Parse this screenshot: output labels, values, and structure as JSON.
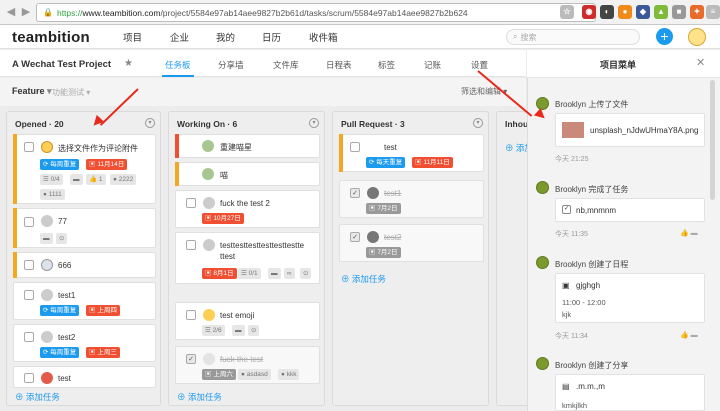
{
  "browser": {
    "url_prefix": "https://",
    "url_host": "www.teambition.com",
    "url_path": "/project/5584e97ab14aee9827b2b61d/tasks/scrum/5584e97ab14aee9827b2b624"
  },
  "nav": {
    "logo": "teambition",
    "items": [
      "项目",
      "企业",
      "我的",
      "日历",
      "收件箱"
    ],
    "search_placeholder": "搜索",
    "add_label": "+"
  },
  "project": {
    "title": "A Wechat Test Project",
    "star": "★",
    "tabs": [
      "任务板",
      "分享墙",
      "文件库",
      "日程表",
      "标签",
      "记账",
      "设置"
    ]
  },
  "feature": {
    "title": "Feature",
    "arrow": "▾",
    "subtitle": "功能测试",
    "chev": "▾",
    "filter": "筛选和编辑 ▾"
  },
  "columns": [
    {
      "title": "Opened · 20",
      "cards": [
        {
          "title": "选择文件作为评论附件",
          "tags": [
            "每周重复",
            "11月14日"
          ],
          "meta": [
            "0/4",
            "1",
            "2222",
            "1111"
          ]
        },
        {
          "title": "77"
        },
        {
          "title": "666"
        },
        {
          "title": "test1",
          "tags": [
            "每周重复",
            "上周四"
          ]
        },
        {
          "title": "test2",
          "tags": [
            "每周重复",
            "上周三"
          ]
        },
        {
          "title": "test"
        }
      ],
      "add": "添加任务"
    },
    {
      "title": "Working On · 6",
      "cards": [
        {
          "title": "重建喵星"
        },
        {
          "title": "喵"
        },
        {
          "title": "fuck the test 2",
          "tags": [
            "10月27日"
          ]
        },
        {
          "title": "testtesttesttesttesttestte",
          "title2": "ttest",
          "tags": [
            "8月1日",
            "0/1"
          ]
        },
        {
          "title": "test emoji",
          "tags": [
            "2/6"
          ]
        },
        {
          "title": "fuck the test",
          "tags": [
            "上周六",
            "asdasd",
            "kkk"
          ]
        }
      ],
      "add": "添加任务"
    },
    {
      "title": "Pull Request · 3",
      "cards": [
        {
          "title": "test",
          "tags": [
            "每天重复",
            "11月11日"
          ]
        },
        {
          "title": "test1",
          "tags": [
            "7月2日"
          ]
        },
        {
          "title": "test2",
          "tags": [
            "7月2日"
          ]
        }
      ],
      "add": "添加任务"
    },
    {
      "title": "Inhou",
      "add": "添加"
    }
  ],
  "panel": {
    "title": "项目菜单",
    "close": "✕",
    "activities": [
      {
        "text": "Brooklyn 上传了文件",
        "file": "unsplash_nJdwUHmaY8A.png",
        "time": "今天 21:25"
      },
      {
        "text": "Brooklyn 完成了任务",
        "task": "nb,mnmnm",
        "time": "今天 11:35"
      },
      {
        "text": "Brooklyn 创建了日程",
        "event": "gjghgh",
        "event_time": "11:00 - 12:00",
        "event_loc": "kjk",
        "time": "今天 11:34"
      },
      {
        "text": "Brooklyn 创建了分享",
        "share": ".m.m.,m",
        "share2": "kmkjlkh"
      }
    ]
  },
  "colors": {
    "accent": "#1b9aee",
    "red": "#f04f31",
    "orange": "#f5a623"
  }
}
